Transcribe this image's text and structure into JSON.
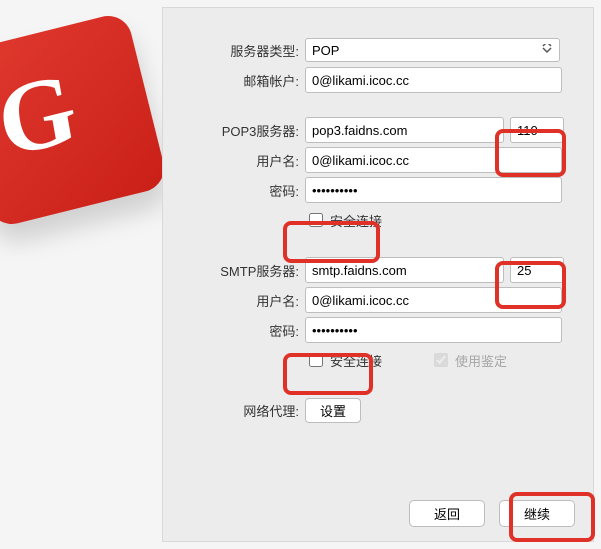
{
  "labels": {
    "server_type": "服务器类型:",
    "mail_account": "邮箱帐户:",
    "pop3_server": "POP3服务器:",
    "username": "用户名:",
    "password": "密码:",
    "secure_conn": "安全连接",
    "smtp_server": "SMTP服务器:",
    "use_auth": "使用鉴定",
    "proxy": "网络代理:",
    "settings": "设置",
    "back": "返回",
    "continue": "继续"
  },
  "values": {
    "server_type": "POP",
    "mail_account": "0@likami.icoc.cc",
    "pop3_host": "pop3.faidns.com",
    "pop3_port": "110",
    "pop3_user": "0@likami.icoc.cc",
    "pop3_pass": "••••••••••",
    "pop3_secure": false,
    "smtp_host": "smtp.faidns.com",
    "smtp_port": "25",
    "smtp_user": "0@likami.icoc.cc",
    "smtp_pass": "••••••••••",
    "smtp_secure": false,
    "smtp_auth": true
  }
}
